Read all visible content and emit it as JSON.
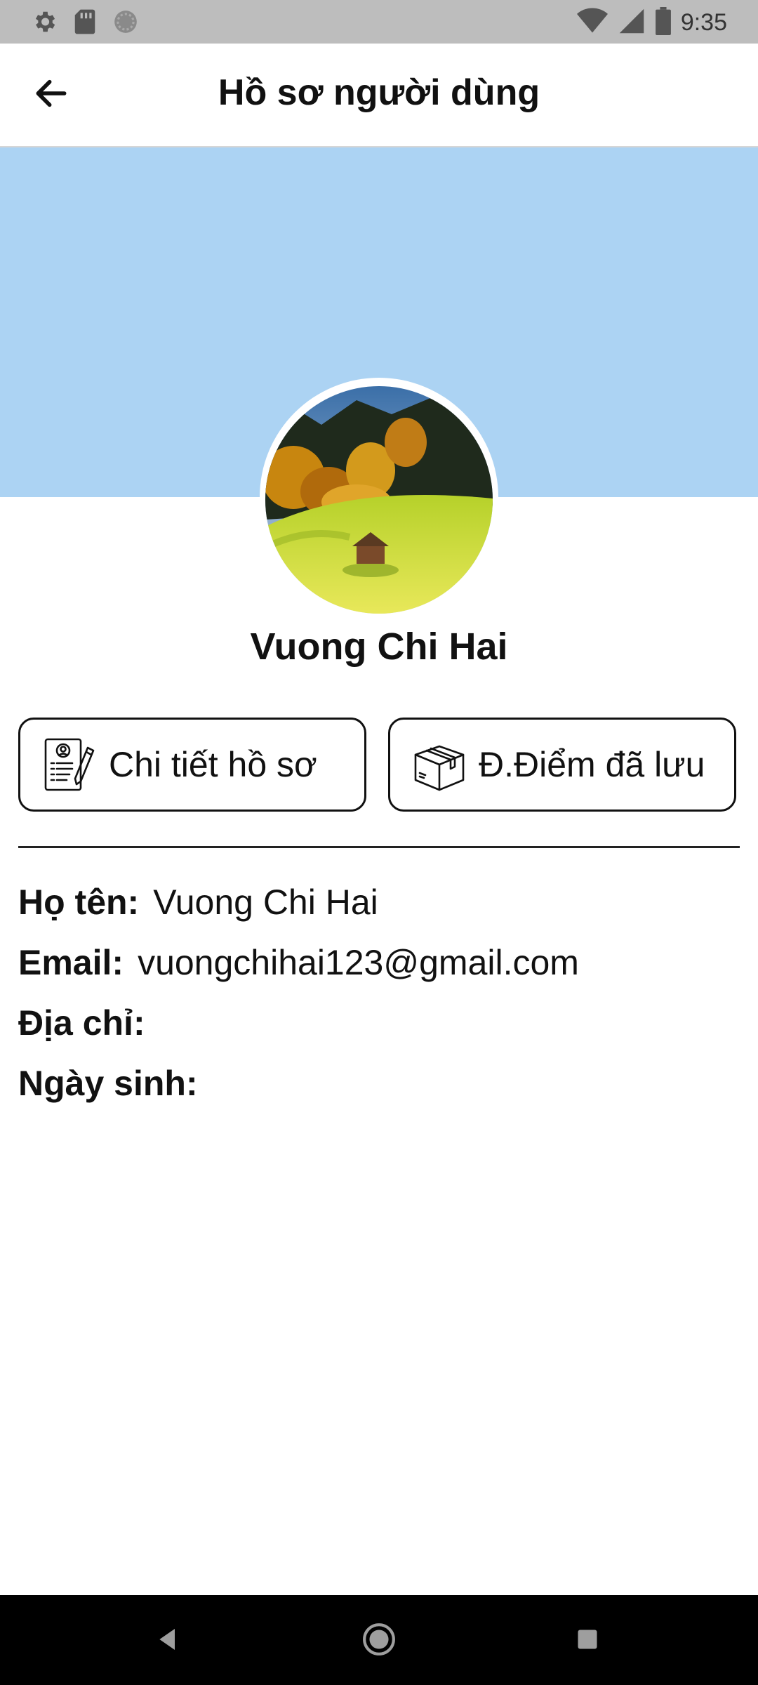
{
  "status_bar": {
    "time": "9:35",
    "icons": [
      "settings-icon",
      "sd-card-icon",
      "circle-icon",
      "wifi-icon",
      "signal-icon",
      "battery-icon"
    ]
  },
  "app_bar": {
    "title": "Hồ sơ người dùng",
    "back_icon": "arrow-left-icon"
  },
  "profile": {
    "name": "Vuong Chi Hai",
    "cover_color": "#acd3f3"
  },
  "actions": {
    "detail_label": "Chi tiết hồ sơ",
    "detail_icon": "profile-document-icon",
    "saved_label": "Đ.Điểm đã lưu",
    "saved_icon": "box-icon"
  },
  "info": {
    "name_label": "Họ tên:",
    "name_value": "Vuong Chi Hai",
    "email_label": "Email:",
    "email_value": "vuongchihai123@gmail.com",
    "address_label": "Địa chỉ:",
    "address_value": "",
    "dob_label": "Ngày sinh:",
    "dob_value": ""
  },
  "nav_bar": {
    "icons": [
      "back-triangle-icon",
      "home-circle-icon",
      "recents-square-icon"
    ]
  }
}
